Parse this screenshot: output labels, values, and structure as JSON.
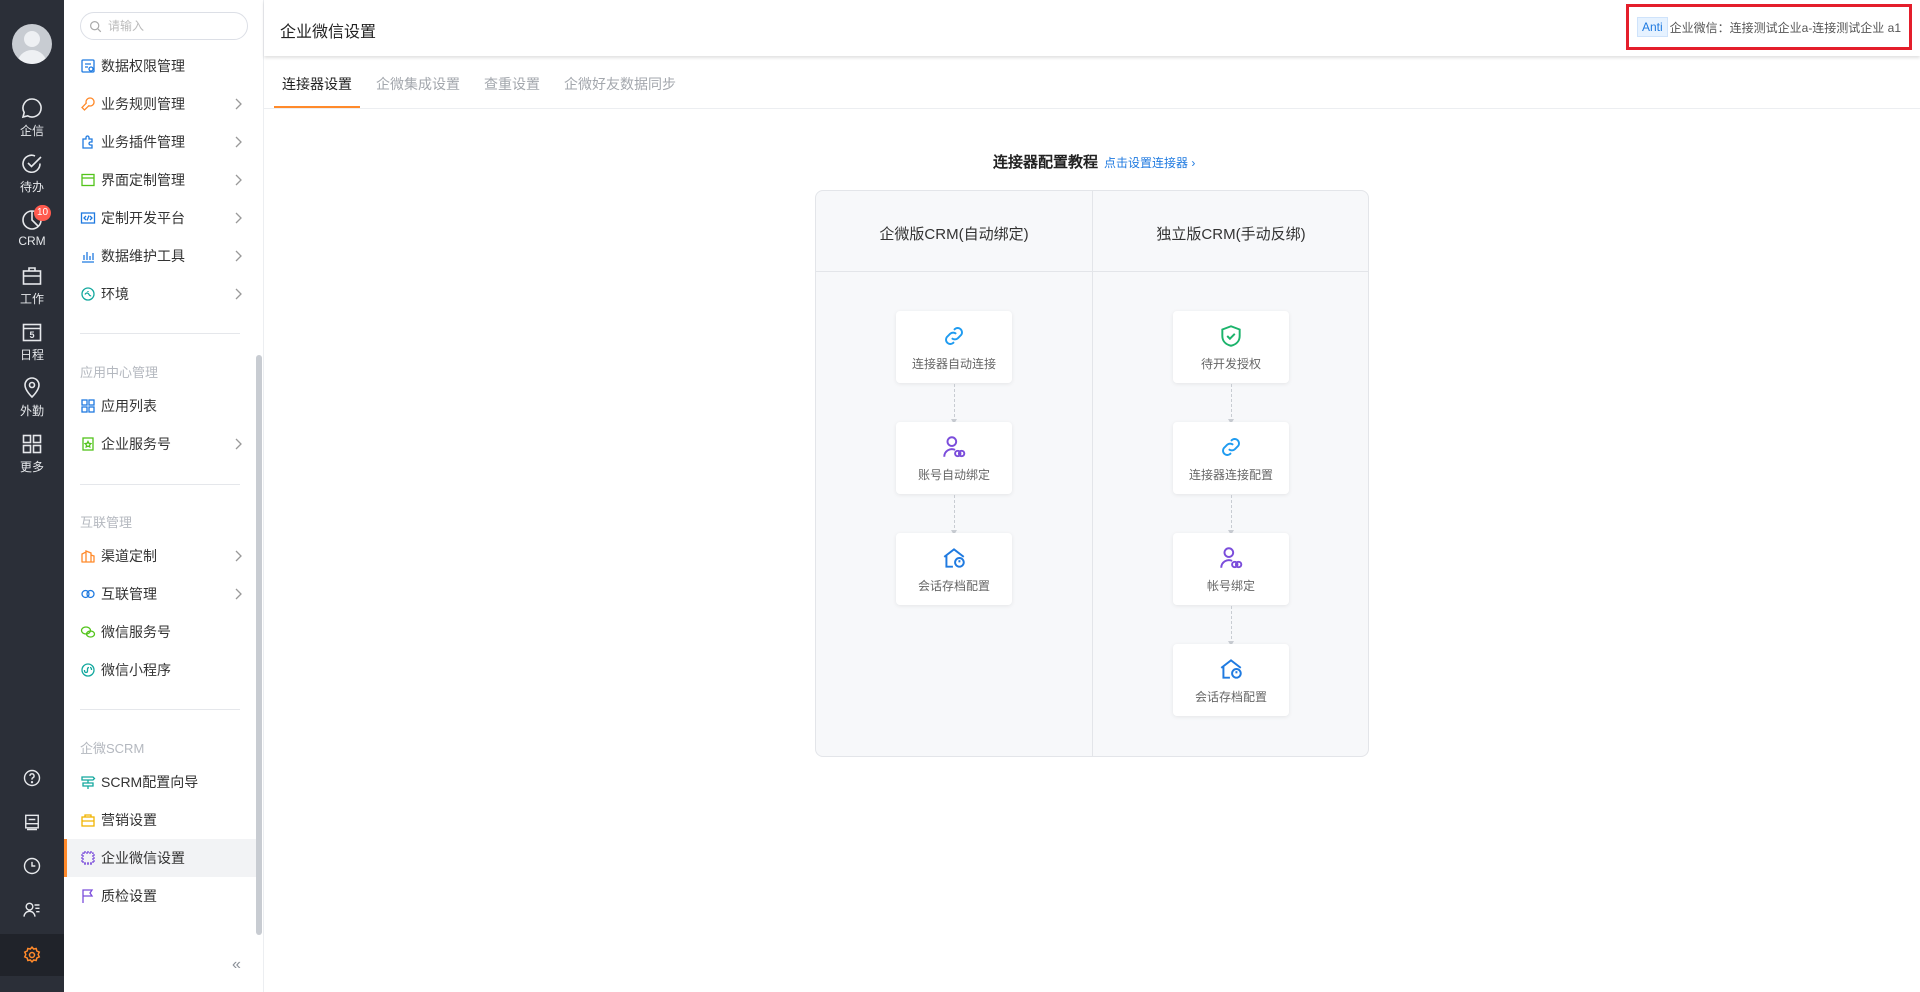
{
  "rail": {
    "items": [
      {
        "label": "企信",
        "icon": "chat-icon"
      },
      {
        "label": "待办",
        "icon": "check-circle-icon"
      },
      {
        "label": "CRM",
        "icon": "crm-icon",
        "badge": "10"
      },
      {
        "label": "工作",
        "icon": "briefcase-icon"
      },
      {
        "label": "日程",
        "icon": "calendar-icon",
        "day": "5"
      },
      {
        "label": "外勤",
        "icon": "location-icon"
      },
      {
        "label": "更多",
        "icon": "grid-icon"
      }
    ]
  },
  "sidebar": {
    "search_placeholder": "请输入",
    "items_top": [
      {
        "label": "数据权限管理",
        "icon": "data-permission-icon"
      },
      {
        "label": "业务规则管理",
        "icon": "rule-icon"
      },
      {
        "label": "业务插件管理",
        "icon": "plugin-icon"
      },
      {
        "label": "界面定制管理",
        "icon": "layout-icon"
      },
      {
        "label": "定制开发平台",
        "icon": "code-icon"
      },
      {
        "label": "数据维护工具",
        "icon": "bar-chart-icon"
      },
      {
        "label": "环境",
        "icon": "environment-icon"
      }
    ],
    "group_app": "应用中心管理",
    "items_app": [
      {
        "label": "应用列表",
        "icon": "app-grid-icon"
      },
      {
        "label": "企业服务号",
        "icon": "service-account-icon"
      }
    ],
    "group_interconnect": "互联管理",
    "items_interconnect": [
      {
        "label": "渠道定制",
        "icon": "channel-icon"
      },
      {
        "label": "互联管理",
        "icon": "link-rings-icon"
      },
      {
        "label": "微信服务号",
        "icon": "wechat-icon"
      },
      {
        "label": "微信小程序",
        "icon": "mini-program-icon"
      }
    ],
    "group_scrm": "企微SCRM",
    "items_scrm": [
      {
        "label": "SCRM配置向导",
        "icon": "guide-icon"
      },
      {
        "label": "营销设置",
        "icon": "marketing-icon"
      },
      {
        "label": "企业微信设置",
        "icon": "chip-icon"
      },
      {
        "label": "质检设置",
        "icon": "flag-icon"
      }
    ],
    "collapse_glyph": "«"
  },
  "header": {
    "title": "企业微信设置",
    "tenant_tag": "Anti",
    "tenant_text": "企业微信：连接测试企业a-连接测试企业 a1"
  },
  "tabs": [
    "连接器设置",
    "企微集成设置",
    "查重设置",
    "企微好友数据同步"
  ],
  "tutorial": {
    "title": "连接器配置教程",
    "link": "点击设置连接器",
    "link_glyph": "›",
    "columns": [
      {
        "title": "企微版CRM(自动绑定)",
        "steps": [
          "连接器自动连接",
          "账号自动绑定",
          "会话存档配置"
        ]
      },
      {
        "title": "独立版CRM(手动反绑)",
        "steps": [
          "待开发授权",
          "连接器连接配置",
          "帐号绑定",
          "会话存档配置"
        ]
      }
    ]
  },
  "colors": {
    "accent": "#ff8a2b",
    "link": "#1f7ae0",
    "rail": "#2b2f38",
    "highlight_border": "#e41e2b"
  }
}
